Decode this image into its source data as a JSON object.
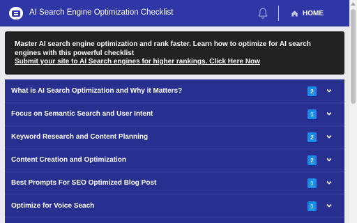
{
  "header": {
    "title": "AI Search Engine Optimization Checklist",
    "home_label": "HOME",
    "brand_color": "#2f36a6"
  },
  "notice": {
    "line1": "Master AI search engine optimization and rank faster. Learn how to optimize for AI search engines with this powerful checklist",
    "link": "Submit your site to AI Search engines for higher rankings. Click Here Now"
  },
  "items": [
    {
      "label": "What is AI Search Optimization and Why it Matters?",
      "count": "2"
    },
    {
      "label": "Focus on Semantic Search and User Intent",
      "count": "1"
    },
    {
      "label": "Keyword Research and Content Planning",
      "count": "2"
    },
    {
      "label": "Content Creation and Optimization",
      "count": "2"
    },
    {
      "label": "Best Prompts For SEO Optimized Blog Post",
      "count": "1"
    },
    {
      "label": "Optimize for Voice Seach",
      "count": "1"
    }
  ],
  "icons": {
    "logo": "checklist-logo-icon",
    "bell": "bell-icon",
    "home": "home-icon",
    "expand": "chevron-down-icon"
  }
}
